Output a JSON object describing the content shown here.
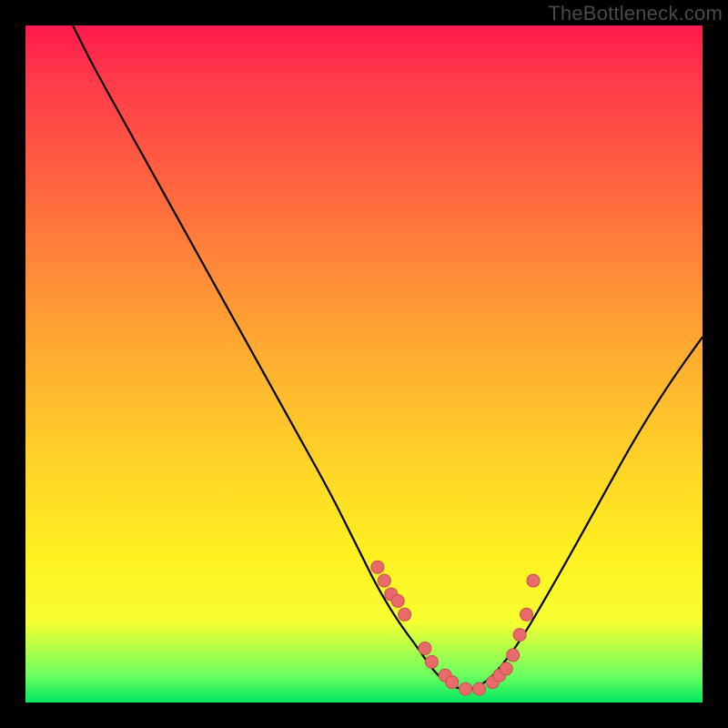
{
  "watermark": "TheBottleneck.com",
  "chart_data": {
    "type": "line",
    "title": "",
    "xlabel": "",
    "ylabel": "",
    "xlim": [
      0,
      100
    ],
    "ylim": [
      0,
      100
    ],
    "grid": false,
    "legend": false,
    "background_gradient": [
      "#ff1a4d",
      "#ffd228",
      "#00e860"
    ],
    "series": [
      {
        "name": "curve",
        "x": [
          7,
          10,
          15,
          20,
          25,
          30,
          35,
          40,
          45,
          48,
          50,
          52,
          55,
          58,
          60,
          62,
          64,
          66,
          68,
          70,
          73,
          76,
          80,
          85,
          90,
          95,
          100
        ],
        "y": [
          100,
          94,
          85,
          76,
          67,
          58,
          49,
          40,
          31,
          25,
          21,
          17,
          12,
          8,
          5,
          3,
          2,
          2,
          3,
          5,
          9,
          14,
          21,
          30,
          39,
          47,
          54
        ]
      }
    ],
    "highlight_points": {
      "name": "dots",
      "x": [
        52,
        53,
        54,
        55,
        56,
        59,
        60,
        62,
        63,
        65,
        67,
        69,
        70,
        71,
        72,
        73,
        74,
        75
      ],
      "y": [
        20,
        18,
        16,
        15,
        13,
        8,
        6,
        4,
        3,
        2,
        2,
        3,
        4,
        5,
        7,
        10,
        13,
        18
      ]
    }
  }
}
